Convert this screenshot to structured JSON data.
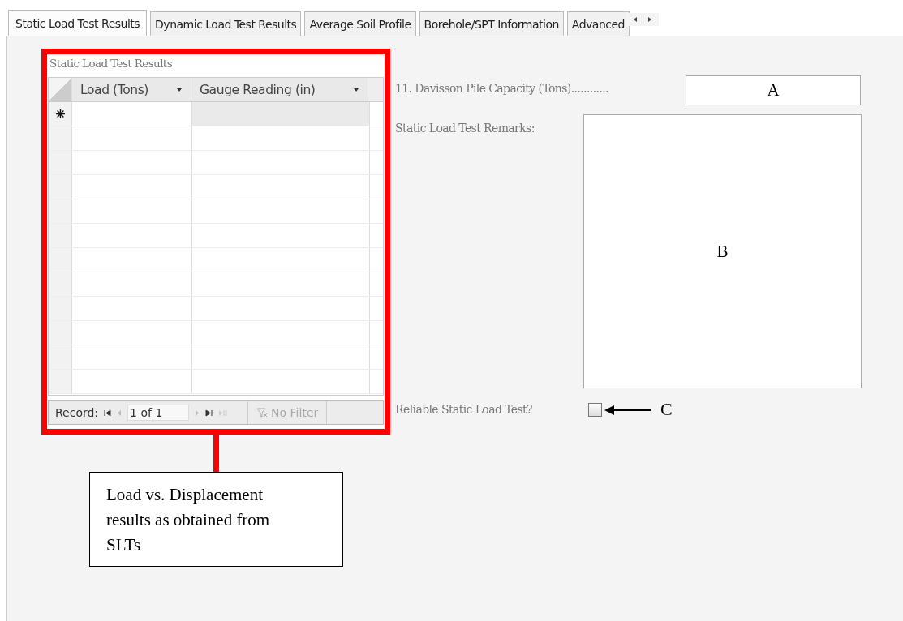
{
  "tabs": [
    {
      "label": "Static Load Test Results",
      "selected": true
    },
    {
      "label": "Dynamic Load Test Results",
      "selected": false
    },
    {
      "label": "Average Soil Profile",
      "selected": false
    },
    {
      "label": "Borehole/SPT Information",
      "selected": false
    },
    {
      "label": "Advanced",
      "selected": false
    }
  ],
  "subform": {
    "title": "Static Load Test Results",
    "columns": [
      "Load (Tons)",
      "Gauge Reading (in)"
    ],
    "navigation": {
      "label": "Record:",
      "position": "1 of 1",
      "filter": "No Filter"
    }
  },
  "capacity_field": {
    "label": "11. Davisson Pile Capacity (Tons)............",
    "value": "A"
  },
  "remarks_field": {
    "label": "Static Load Test Remarks:",
    "value": "B"
  },
  "reliable_checkbox": {
    "label": "Reliable Static Load Test?",
    "checked": false
  },
  "annotations": {
    "checkbox_marker": "C",
    "callout": "Load vs. Displacement results as obtained from SLTs"
  }
}
